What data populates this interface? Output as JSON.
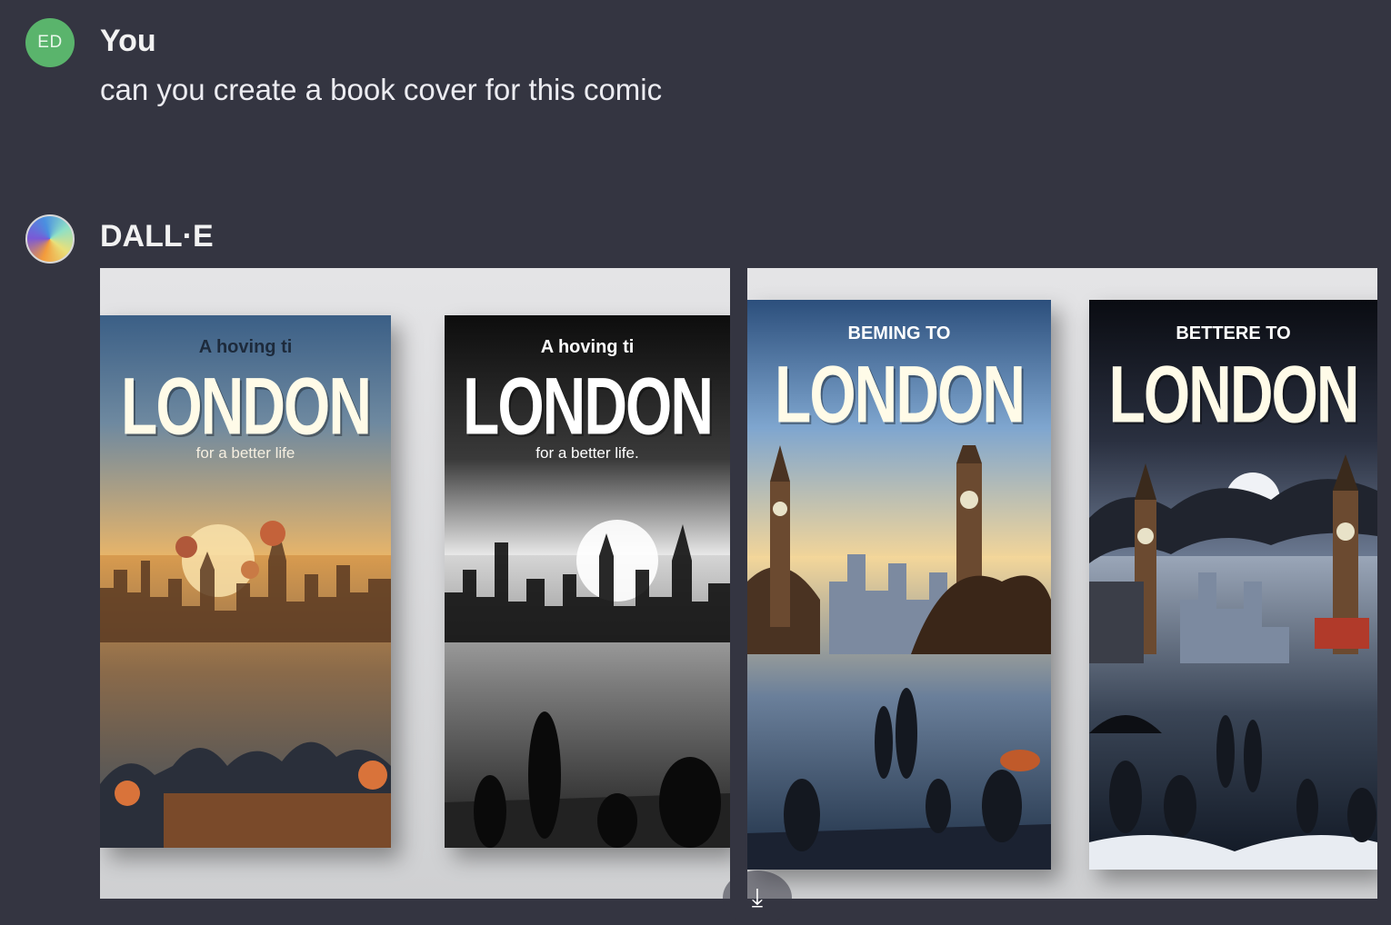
{
  "user_message": {
    "avatar_initials": "ED",
    "author": "You",
    "text": "can you create a book cover for this comic"
  },
  "assistant_message": {
    "author": "DALL·E",
    "images": [
      {
        "covers": [
          {
            "subtitle": "A hoving ti",
            "title": "LONDON",
            "tagline": "for a better life",
            "style": "color-sunset"
          },
          {
            "subtitle": "A hoving ti",
            "title": "LONDON",
            "tagline": "for a better life.",
            "style": "black-white"
          }
        ]
      },
      {
        "covers": [
          {
            "subtitle": "BEMING TO",
            "title": "LONDON",
            "tagline": "",
            "style": "color-day"
          },
          {
            "subtitle": "BETTERE TO",
            "title": "LONDON",
            "tagline": "",
            "style": "color-storm"
          }
        ]
      }
    ],
    "download_icon": "download-arrow-icon"
  },
  "colors": {
    "background": "#343541",
    "user_avatar": "#5ab46c",
    "image_tile": "#d9dadc"
  }
}
